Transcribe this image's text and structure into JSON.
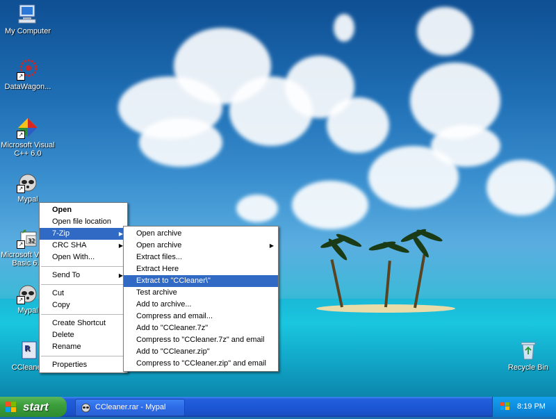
{
  "desktop": {
    "icons": [
      {
        "label": "My Computer",
        "icon": "my-computer-icon"
      },
      {
        "label": "DataWagon...",
        "icon": "datawagon-icon"
      },
      {
        "label": "Microsoft Visual C++ 6.0",
        "icon": "visual-cpp-icon"
      },
      {
        "label": "Mypal",
        "icon": "mypal-icon"
      },
      {
        "label": "Microsoft Visual Basic 6.0",
        "icon": "visual-basic-icon"
      },
      {
        "label": "Mypal",
        "icon": "mypal-icon"
      },
      {
        "label": "CCleaner",
        "icon": "ccleaner-rar-icon"
      },
      {
        "label": "Recycle Bin",
        "icon": "recycle-bin-icon"
      }
    ]
  },
  "context_menu": {
    "items": [
      {
        "label": "Open",
        "bold": true
      },
      {
        "label": "Open file location"
      },
      {
        "label": "7-Zip",
        "submenu": true,
        "selected": true
      },
      {
        "label": "CRC SHA",
        "submenu": true
      },
      {
        "label": "Open With..."
      },
      {
        "label": "Send To",
        "submenu": true
      },
      {
        "label": "Cut"
      },
      {
        "label": "Copy"
      },
      {
        "label": "Create Shortcut"
      },
      {
        "label": "Delete"
      },
      {
        "label": "Rename"
      },
      {
        "label": "Properties"
      }
    ]
  },
  "zip_menu": {
    "items": [
      {
        "label": "Open archive"
      },
      {
        "label": "Open archive",
        "submenu": true
      },
      {
        "label": "Extract files..."
      },
      {
        "label": "Extract Here"
      },
      {
        "label": "Extract to \"CCleaner\\\"",
        "selected": true
      },
      {
        "label": "Test archive"
      },
      {
        "label": "Add to archive..."
      },
      {
        "label": "Compress and email..."
      },
      {
        "label": "Add to \"CCleaner.7z\""
      },
      {
        "label": "Compress to \"CCleaner.7z\" and email"
      },
      {
        "label": "Add to \"CCleaner.zip\""
      },
      {
        "label": "Compress to \"CCleaner.zip\" and email"
      }
    ]
  },
  "taskbar": {
    "start_label": "start",
    "task_label": "CCleaner.rar - Mypal",
    "clock": "8:19 PM"
  },
  "colors": {
    "selection": "#316ac5",
    "taskbar": "#245edb",
    "start_button": "#3c9e3c"
  }
}
